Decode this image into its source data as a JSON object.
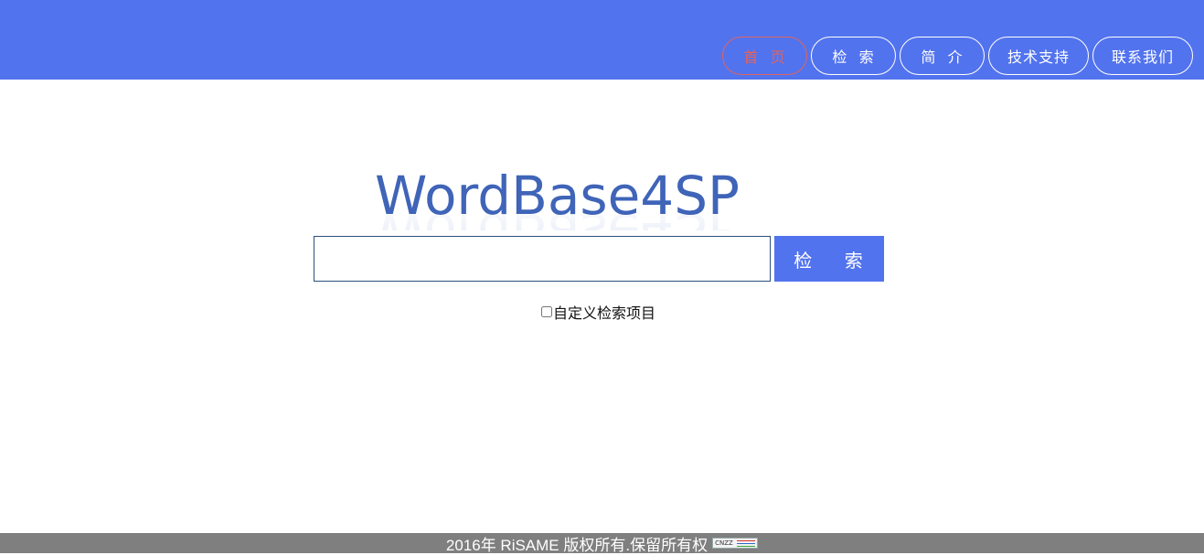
{
  "nav": {
    "items": [
      {
        "label": "首  页",
        "active": true
      },
      {
        "label": "检  索",
        "active": false
      },
      {
        "label": "简  介",
        "active": false
      },
      {
        "label": "技术支持",
        "active": false
      },
      {
        "label": "联系我们",
        "active": false
      }
    ]
  },
  "logo": {
    "text": "WordBase4SP"
  },
  "search": {
    "button_label": "检    索",
    "value": ""
  },
  "options": {
    "custom_label": "自定义检索项目",
    "checked": false
  },
  "footer": {
    "text": "2016年 RiSAME 版权所有.保留所有权",
    "badge_text": "CNZZ"
  },
  "colors": {
    "header": "#5273ee",
    "active_nav": "#e0645f",
    "footer": "#7f7f7f",
    "logo": "#3f64b8"
  }
}
